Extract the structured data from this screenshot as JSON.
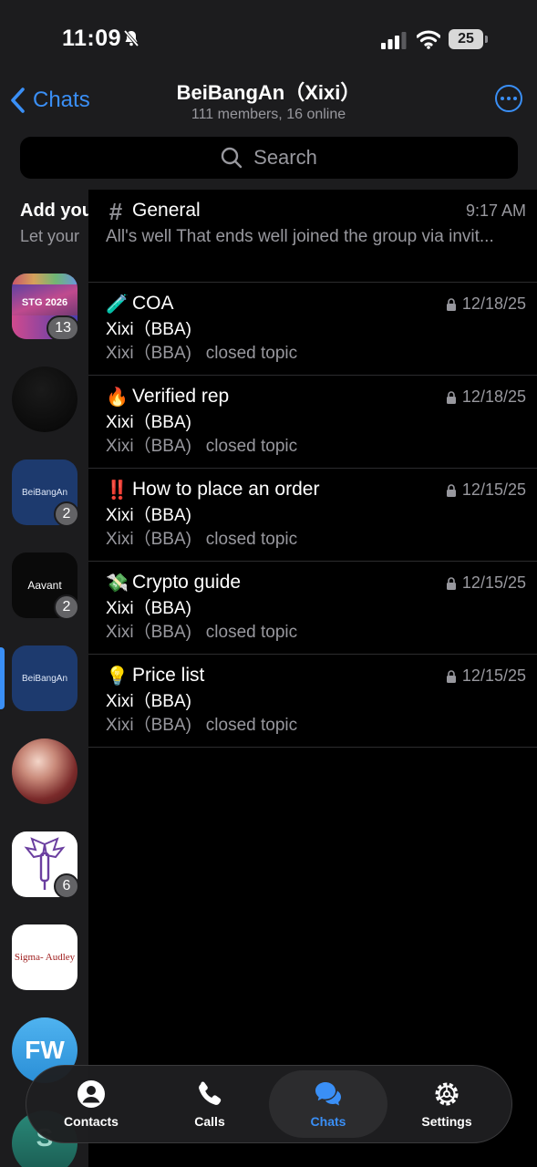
{
  "status_bar": {
    "time": "11:09",
    "battery": "25"
  },
  "nav": {
    "back_label": "Chats",
    "title": "BeiBangAn（Xixi）",
    "subtitle": "111 members, 16 online",
    "search_placeholder": "Search"
  },
  "sidebar": {
    "add_title": "Add you",
    "add_sub": "Let your",
    "avatars": [
      {
        "name": "STG 2026",
        "badge": "13"
      },
      {
        "name": "",
        "badge": ""
      },
      {
        "name": "BeiBangAn",
        "badge": "2"
      },
      {
        "name": "Aavant",
        "badge": "2"
      },
      {
        "name": "BeiBangAn",
        "badge": ""
      },
      {
        "name": "",
        "badge": ""
      },
      {
        "name": "",
        "badge": "6"
      },
      {
        "name": "Sigma- Audley",
        "badge": ""
      },
      {
        "name": "FW",
        "badge": ""
      },
      {
        "name": "S",
        "badge": ""
      }
    ]
  },
  "topics": [
    {
      "icon": "#",
      "name": "General",
      "time": "9:17 AM",
      "preview": "All's well That ends well joined the group via invit..."
    },
    {
      "icon": "🧪",
      "name": "COA",
      "time": "12/18/25",
      "sender": "Xixi（BBA)",
      "message": "Xixi（BBA)   closed topic"
    },
    {
      "icon": "🔥",
      "name": "Verified rep",
      "time": "12/18/25",
      "sender": "Xixi（BBA)",
      "message": "Xixi（BBA)   closed topic"
    },
    {
      "icon": "‼️",
      "name": "How to place an order",
      "time": "12/15/25",
      "sender": "Xixi（BBA)",
      "message": "Xixi（BBA)   closed topic"
    },
    {
      "icon": "💸",
      "name": "Crypto guide",
      "time": "12/15/25",
      "sender": "Xixi（BBA)",
      "message": "Xixi（BBA)   closed topic"
    },
    {
      "icon": "💡",
      "name": "Price list",
      "time": "12/15/25",
      "sender": "Xixi（BBA)",
      "message": "Xixi（BBA)   closed topic"
    }
  ],
  "tabs": [
    {
      "label": "Contacts",
      "icon": "person-circle-icon"
    },
    {
      "label": "Calls",
      "icon": "phone-icon"
    },
    {
      "label": "Chats",
      "icon": "chat-bubbles-icon"
    },
    {
      "label": "Settings",
      "icon": "gear-icon"
    }
  ],
  "colors": {
    "accent": "#3a8ff6",
    "background": "#000000",
    "panel": "#1c1c1e",
    "secondary_text": "#98989e"
  }
}
